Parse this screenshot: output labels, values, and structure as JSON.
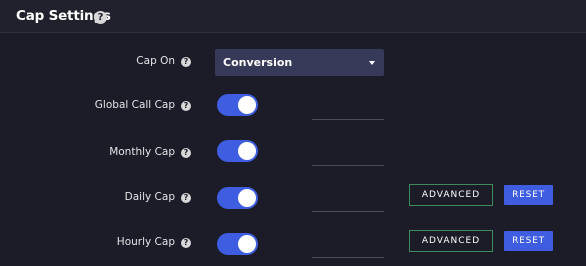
{
  "header": {
    "title": "Cap Settings",
    "help_icon": "help-icon"
  },
  "cap_on": {
    "label": "Cap On",
    "selected": "Conversion"
  },
  "rows": [
    {
      "label": "Global Call Cap",
      "enabled": true,
      "value": ""
    },
    {
      "label": "Monthly Cap",
      "enabled": true,
      "value": ""
    },
    {
      "label": "Daily Cap",
      "enabled": true,
      "value": "",
      "advanced_label": "ADVANCED",
      "reset_label": "RESET"
    },
    {
      "label": "Hourly Cap",
      "enabled": true,
      "value": "",
      "advanced_label": "ADVANCED",
      "reset_label": "RESET"
    }
  ],
  "colors": {
    "background": "#1b1c28",
    "accent": "#3f5de0",
    "select_bg": "#363a58",
    "outline_button_border": "#3f8a5c"
  }
}
